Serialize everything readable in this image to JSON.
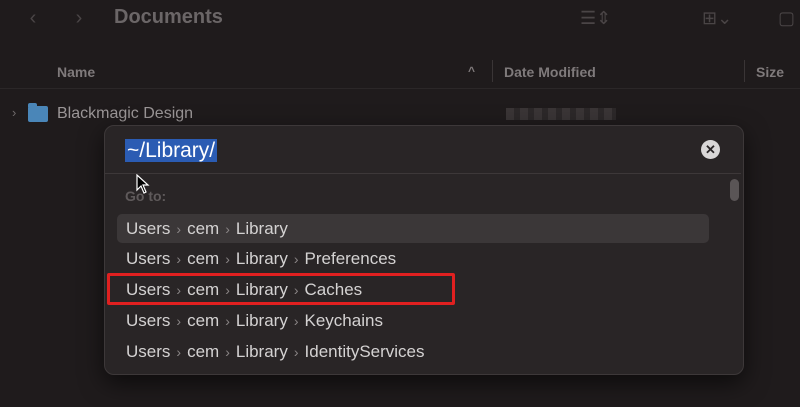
{
  "window": {
    "title": "Documents"
  },
  "columns": {
    "name": "Name",
    "date_modified": "Date Modified",
    "size": "Size"
  },
  "files": [
    {
      "name": "Blackmagic Design"
    }
  ],
  "goto_dialog": {
    "path_value": "~/Library/",
    "section_label": "Go to:",
    "separator": "›",
    "suggestions": [
      {
        "parts": [
          "Users",
          "cem",
          "Library"
        ],
        "selected": true
      },
      {
        "parts": [
          "Users",
          "cem",
          "Library",
          "Preferences"
        ]
      },
      {
        "parts": [
          "Users",
          "cem",
          "Library",
          "Caches"
        ],
        "highlighted_red": true
      },
      {
        "parts": [
          "Users",
          "cem",
          "Library",
          "Keychains"
        ]
      },
      {
        "parts": [
          "Users",
          "cem",
          "Library",
          "IdentityServices"
        ]
      }
    ]
  },
  "colors": {
    "selection": "#2b5cb3",
    "annotation": "#e02020",
    "folder": "#4a86b8"
  }
}
